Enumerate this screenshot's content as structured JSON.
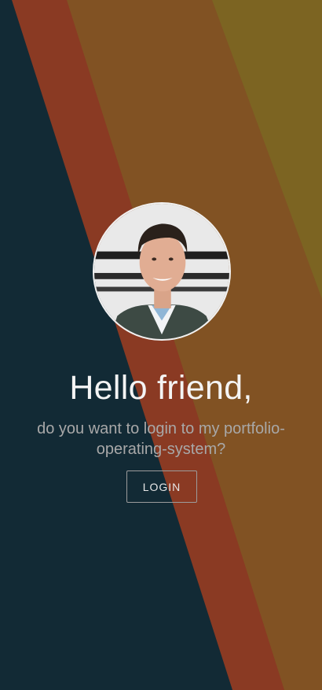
{
  "greeting": {
    "title": "Hello friend,",
    "subtitle": "do you want to login to my portfolio-operating-system?"
  },
  "actions": {
    "login_label": "LOGIN"
  },
  "avatar": {
    "icon": "profile-photo"
  },
  "colors": {
    "background": "#122a35",
    "stripe_red": "#8a3a23",
    "stripe_brown": "#815223",
    "stripe_olive": "#7c6422",
    "text_primary": "#f4f4f4",
    "text_secondary": "#a8a8a8",
    "button_border": "#9c9c9c"
  }
}
